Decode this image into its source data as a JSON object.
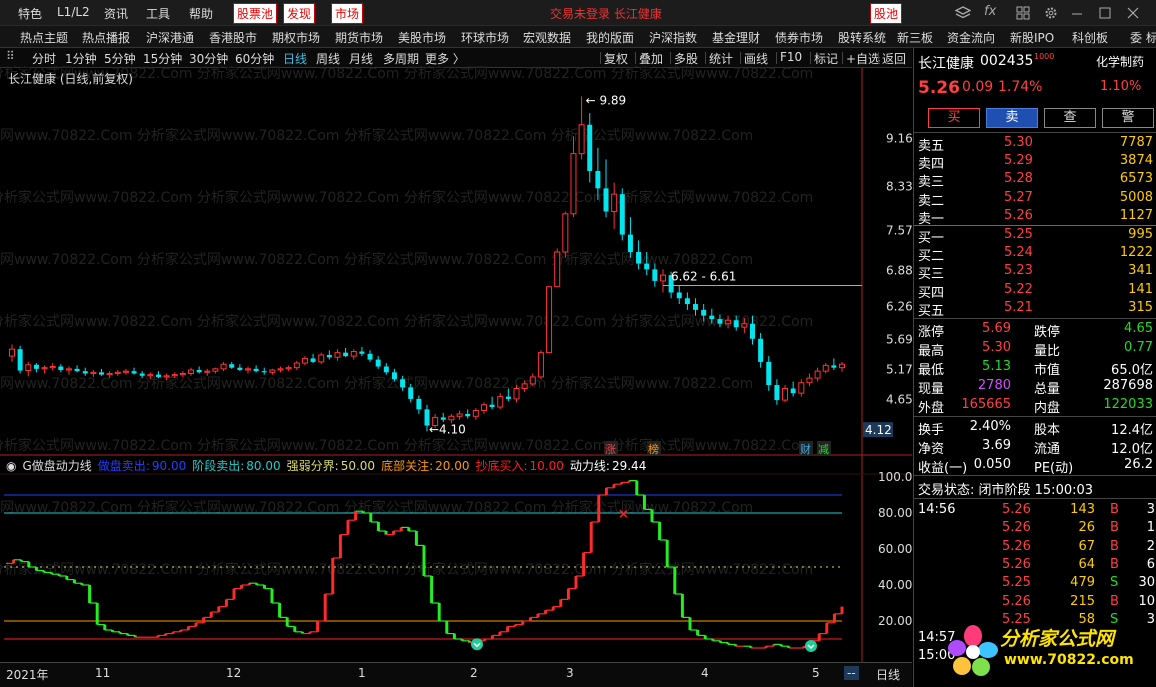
{
  "topbar": {
    "items": [
      "特色",
      "L1/L2",
      "资讯",
      "工具",
      "帮助"
    ],
    "red_items": [
      "股票池",
      "发现",
      "市场"
    ],
    "center_title": "交易未登录 长江健康",
    "right_badge": "股池"
  },
  "navbar": [
    "热点主题",
    "热点播报",
    "沪深港通",
    "香港股市",
    "期权市场",
    "期货市场",
    "美股市场",
    "环球市场",
    "宏观数据",
    "我的版面",
    "沪深指数",
    "基金理财",
    "债券市场",
    "股转系统",
    "新三板",
    "资金流向",
    "新股IPO",
    "科创板",
    "委 标"
  ],
  "periodbar": {
    "left": [
      "分时",
      "1分钟",
      "5分钟",
      "15分钟",
      "30分钟",
      "60分钟",
      "日线",
      "周线",
      "月线",
      "多周期",
      "更多 〉"
    ],
    "active": "日线",
    "right": [
      "复权",
      "叠加",
      "多股",
      "统计",
      "画线",
      "F10",
      "标记",
      "+自选",
      "返回"
    ]
  },
  "chart_title": "长江健康 (日线,前复权)",
  "chart_data": [
    {
      "type": "candlestick",
      "title": "长江健康 (日线,前复权)",
      "y_ticks": [
        9.16,
        8.33,
        7.57,
        6.88,
        6.26,
        5.69,
        5.17,
        4.65
      ],
      "ylim": [
        3.95,
        10.0
      ],
      "annotations": {
        "high": "9.89",
        "low": "4.10",
        "range_label": "6.62 - 6.61",
        "current_tag": "4.12"
      },
      "event_tags": [
        "涨",
        "榜",
        "财",
        "减"
      ],
      "x_tick_labels": [
        "2021年",
        "11",
        "12",
        "1",
        "2",
        "3",
        "4",
        "5"
      ],
      "ohlc": [
        [
          5.4,
          5.6,
          5.3,
          5.52
        ],
        [
          5.52,
          5.58,
          5.1,
          5.15
        ],
        [
          5.15,
          5.3,
          5.05,
          5.25
        ],
        [
          5.25,
          5.28,
          5.12,
          5.18
        ],
        [
          5.18,
          5.24,
          5.1,
          5.2
        ],
        [
          5.2,
          5.28,
          5.15,
          5.22
        ],
        [
          5.22,
          5.26,
          5.12,
          5.16
        ],
        [
          5.16,
          5.22,
          5.08,
          5.18
        ],
        [
          5.18,
          5.24,
          5.12,
          5.14
        ],
        [
          5.14,
          5.2,
          5.06,
          5.1
        ],
        [
          5.1,
          5.16,
          5.04,
          5.12
        ],
        [
          5.12,
          5.18,
          5.06,
          5.08
        ],
        [
          5.08,
          5.14,
          5.02,
          5.1
        ],
        [
          5.1,
          5.16,
          5.06,
          5.12
        ],
        [
          5.12,
          5.18,
          5.08,
          5.14
        ],
        [
          5.14,
          5.2,
          5.08,
          5.1
        ],
        [
          5.1,
          5.14,
          5.02,
          5.06
        ],
        [
          5.06,
          5.12,
          5.0,
          5.08
        ],
        [
          5.08,
          5.14,
          5.02,
          5.04
        ],
        [
          5.04,
          5.1,
          4.98,
          5.06
        ],
        [
          5.06,
          5.12,
          5.02,
          5.08
        ],
        [
          5.08,
          5.14,
          5.04,
          5.1
        ],
        [
          5.1,
          5.2,
          5.06,
          5.16
        ],
        [
          5.16,
          5.22,
          5.1,
          5.12
        ],
        [
          5.12,
          5.18,
          5.06,
          5.14
        ],
        [
          5.14,
          5.2,
          5.1,
          5.18
        ],
        [
          5.18,
          5.3,
          5.14,
          5.26
        ],
        [
          5.26,
          5.3,
          5.18,
          5.2
        ],
        [
          5.2,
          5.26,
          5.14,
          5.16
        ],
        [
          5.16,
          5.22,
          5.1,
          5.18
        ],
        [
          5.18,
          5.24,
          5.12,
          5.14
        ],
        [
          5.14,
          5.2,
          5.08,
          5.12
        ],
        [
          5.12,
          5.18,
          5.08,
          5.16
        ],
        [
          5.16,
          5.22,
          5.12,
          5.18
        ],
        [
          5.18,
          5.24,
          5.14,
          5.2
        ],
        [
          5.2,
          5.32,
          5.16,
          5.28
        ],
        [
          5.28,
          5.4,
          5.24,
          5.36
        ],
        [
          5.36,
          5.44,
          5.28,
          5.3
        ],
        [
          5.3,
          5.46,
          5.26,
          5.42
        ],
        [
          5.42,
          5.5,
          5.34,
          5.38
        ],
        [
          5.38,
          5.52,
          5.32,
          5.46
        ],
        [
          5.46,
          5.54,
          5.38,
          5.4
        ],
        [
          5.4,
          5.52,
          5.34,
          5.48
        ],
        [
          5.48,
          5.56,
          5.4,
          5.44
        ],
        [
          5.44,
          5.5,
          5.3,
          5.34
        ],
        [
          5.34,
          5.4,
          5.18,
          5.22
        ],
        [
          5.22,
          5.28,
          5.08,
          5.12
        ],
        [
          5.12,
          5.18,
          4.96,
          5.0
        ],
        [
          5.0,
          5.06,
          4.8,
          4.86
        ],
        [
          4.86,
          4.92,
          4.6,
          4.66
        ],
        [
          4.66,
          4.72,
          4.4,
          4.48
        ],
        [
          4.48,
          4.56,
          4.1,
          4.2
        ],
        [
          4.2,
          4.4,
          4.16,
          4.34
        ],
        [
          4.34,
          4.42,
          4.26,
          4.3
        ],
        [
          4.3,
          4.4,
          4.24,
          4.36
        ],
        [
          4.36,
          4.46,
          4.3,
          4.4
        ],
        [
          4.4,
          4.48,
          4.32,
          4.36
        ],
        [
          4.36,
          4.5,
          4.3,
          4.46
        ],
        [
          4.46,
          4.6,
          4.4,
          4.56
        ],
        [
          4.56,
          4.7,
          4.48,
          4.52
        ],
        [
          4.52,
          4.76,
          4.48,
          4.7
        ],
        [
          4.7,
          4.84,
          4.62,
          4.66
        ],
        [
          4.66,
          4.9,
          4.6,
          4.84
        ],
        [
          4.84,
          4.98,
          4.78,
          4.92
        ],
        [
          4.92,
          5.1,
          4.88,
          5.04
        ],
        [
          5.04,
          5.5,
          5.0,
          5.46
        ],
        [
          5.46,
          6.6,
          5.46,
          6.6
        ],
        [
          6.6,
          7.26,
          6.6,
          7.2
        ],
        [
          7.2,
          7.9,
          7.1,
          7.86
        ],
        [
          7.86,
          9.2,
          7.8,
          8.9
        ],
        [
          8.9,
          9.89,
          8.8,
          9.4
        ],
        [
          9.4,
          9.6,
          8.4,
          8.6
        ],
        [
          8.6,
          9.0,
          8.1,
          8.3
        ],
        [
          8.3,
          8.8,
          7.8,
          7.9
        ],
        [
          7.9,
          8.4,
          7.6,
          8.2
        ],
        [
          8.2,
          8.3,
          7.4,
          7.5
        ],
        [
          7.5,
          7.8,
          7.1,
          7.2
        ],
        [
          7.2,
          7.4,
          6.9,
          7.0
        ],
        [
          7.0,
          7.2,
          6.8,
          6.9
        ],
        [
          6.9,
          7.0,
          6.6,
          6.7
        ],
        [
          6.7,
          6.9,
          6.5,
          6.8
        ],
        [
          6.8,
          6.86,
          6.4,
          6.5
        ],
        [
          6.5,
          6.62,
          6.3,
          6.4
        ],
        [
          6.4,
          6.5,
          6.2,
          6.3
        ],
        [
          6.3,
          6.4,
          6.1,
          6.2
        ],
        [
          6.2,
          6.3,
          6.0,
          6.1
        ],
        [
          6.1,
          6.22,
          5.96,
          6.04
        ],
        [
          6.04,
          6.12,
          5.9,
          5.96
        ],
        [
          5.96,
          6.1,
          5.88,
          6.02
        ],
        [
          6.02,
          6.1,
          5.84,
          5.9
        ],
        [
          5.9,
          6.06,
          5.8,
          5.96
        ],
        [
          5.96,
          6.1,
          5.6,
          5.7
        ],
        [
          5.7,
          5.8,
          5.2,
          5.3
        ],
        [
          5.3,
          5.4,
          4.8,
          4.9
        ],
        [
          4.9,
          5.0,
          4.56,
          4.64
        ],
        [
          4.64,
          4.9,
          4.6,
          4.84
        ],
        [
          4.84,
          4.96,
          4.7,
          4.76
        ],
        [
          4.76,
          5.0,
          4.7,
          4.94
        ],
        [
          4.94,
          5.1,
          4.88,
          5.02
        ],
        [
          5.02,
          5.2,
          4.96,
          5.14
        ],
        [
          5.14,
          5.28,
          5.1,
          5.24
        ],
        [
          5.24,
          5.36,
          5.16,
          5.2
        ],
        [
          5.2,
          5.3,
          5.13,
          5.26
        ]
      ]
    },
    {
      "type": "line",
      "title": "G做盘动力线",
      "params": [
        {
          "name": "做盘卖出",
          "value": "90.00",
          "color": "#2040ff"
        },
        {
          "name": "阶段卖出",
          "value": "80.00",
          "color": "#22cccc"
        },
        {
          "name": "强弱分界",
          "value": "50.00",
          "color": "#dddd66"
        },
        {
          "name": "底部关注",
          "value": "20.00",
          "color": "#ff9900"
        },
        {
          "name": "抄底买入",
          "value": "10.00",
          "color": "#ff2020"
        },
        {
          "name": "动力线",
          "value": "29.44",
          "color": "#ffffff"
        }
      ],
      "y_ticks": [
        100.0,
        80.0,
        60.0,
        40.0,
        20.0
      ],
      "ylim": [
        0,
        100
      ],
      "values": [
        52,
        54,
        53,
        50,
        48,
        47,
        46,
        45,
        43,
        41,
        40,
        30,
        18,
        15,
        14,
        13,
        12,
        11,
        11,
        11,
        12,
        13,
        14,
        15,
        17,
        19,
        22,
        25,
        28,
        32,
        38,
        40,
        41,
        40,
        38,
        30,
        22,
        17,
        14,
        13,
        14,
        20,
        35,
        55,
        68,
        76,
        81,
        80,
        75,
        70,
        68,
        70,
        72,
        70,
        62,
        45,
        30,
        20,
        13,
        10,
        9,
        8,
        9,
        10,
        12,
        14,
        17,
        18,
        20,
        22,
        24,
        26,
        28,
        32,
        38,
        45,
        58,
        75,
        90,
        94,
        96,
        97,
        98,
        90,
        82,
        75,
        65,
        50,
        35,
        22,
        15,
        12,
        10,
        9,
        8,
        7,
        6,
        6,
        5,
        5,
        6,
        7,
        6,
        5,
        5,
        6,
        9,
        13,
        19,
        24,
        28
      ]
    }
  ],
  "stock_panel": {
    "name": "长江健康",
    "code": "002435",
    "industry": "化学制药",
    "price": "5.26",
    "change": "0.09",
    "change_pct": "1.74%",
    "side_pct": "1.10%",
    "buttons": [
      "买",
      "卖",
      "查",
      "警"
    ],
    "asks": [
      {
        "label": "卖五",
        "price": "5.30",
        "vol": "7787"
      },
      {
        "label": "卖四",
        "price": "5.29",
        "vol": "3874"
      },
      {
        "label": "卖三",
        "price": "5.28",
        "vol": "6573"
      },
      {
        "label": "卖二",
        "price": "5.27",
        "vol": "5008"
      },
      {
        "label": "卖一",
        "price": "5.26",
        "vol": "1127"
      }
    ],
    "bids": [
      {
        "label": "买一",
        "price": "5.25",
        "vol": "995"
      },
      {
        "label": "买二",
        "price": "5.24",
        "vol": "1222"
      },
      {
        "label": "买三",
        "price": "5.23",
        "vol": "341"
      },
      {
        "label": "买四",
        "price": "5.22",
        "vol": "141"
      },
      {
        "label": "买五",
        "price": "5.21",
        "vol": "315"
      }
    ],
    "stats": [
      {
        "l1": "涨停",
        "v1": "5.69",
        "c1": "red",
        "l2": "跌停",
        "v2": "4.65",
        "c2": "green"
      },
      {
        "l1": "最高",
        "v1": "5.30",
        "c1": "red",
        "l2": "量比",
        "v2": "0.77",
        "c2": "green"
      },
      {
        "l1": "最低",
        "v1": "5.13",
        "c1": "green",
        "l2": "市值",
        "v2": "65.0亿",
        "c2": "white"
      },
      {
        "l1": "现量",
        "v1": "2780",
        "c1": "purple",
        "l2": "总量",
        "v2": "287698",
        "c2": "white"
      },
      {
        "l1": "外盘",
        "v1": "165665",
        "c1": "red",
        "l2": "内盘",
        "v2": "122033",
        "c2": "green"
      }
    ],
    "stats2": [
      {
        "l1": "换手",
        "v1": "2.40%",
        "l2": "股本",
        "v2": "12.4亿"
      },
      {
        "l1": "净资",
        "v1": "3.69",
        "l2": "流通",
        "v2": "12.0亿"
      },
      {
        "l1": "收益(一)",
        "v1": "0.050",
        "l2": "PE(动)",
        "v2": "26.2"
      }
    ],
    "trade_status": "交易状态: 闭市阶段 15:00:03",
    "ticks": [
      {
        "time": "14:56",
        "price": "5.26",
        "vol": "143",
        "side": "B",
        "n": "3"
      },
      {
        "time": "",
        "price": "5.26",
        "vol": "26",
        "side": "B",
        "n": "1"
      },
      {
        "time": "",
        "price": "5.26",
        "vol": "67",
        "side": "B",
        "n": "2"
      },
      {
        "time": "",
        "price": "5.26",
        "vol": "64",
        "side": "B",
        "n": "6"
      },
      {
        "time": "",
        "price": "5.25",
        "vol": "479",
        "side": "S",
        "n": "30"
      },
      {
        "time": "",
        "price": "5.26",
        "vol": "215",
        "side": "B",
        "n": "10"
      },
      {
        "time": "",
        "price": "5.25",
        "vol": "58",
        "side": "S",
        "n": "3"
      },
      {
        "time": "14:57",
        "price": "",
        "vol": "",
        "side": "",
        "n": ""
      },
      {
        "time": "15:00",
        "price": "",
        "vol": "",
        "side": "",
        "n": ""
      }
    ]
  },
  "bottom_axis": {
    "period": "日线",
    "dashes": "--"
  },
  "watermark": "分析家公式网www.70822.Com",
  "logo": {
    "title": "分析家公式网",
    "url": "www.70822.com"
  },
  "colors": {
    "up": "#ff3333",
    "down": "#00e5ee",
    "ind_up": "#ff2a2a",
    "ind_down": "#22ee22"
  }
}
